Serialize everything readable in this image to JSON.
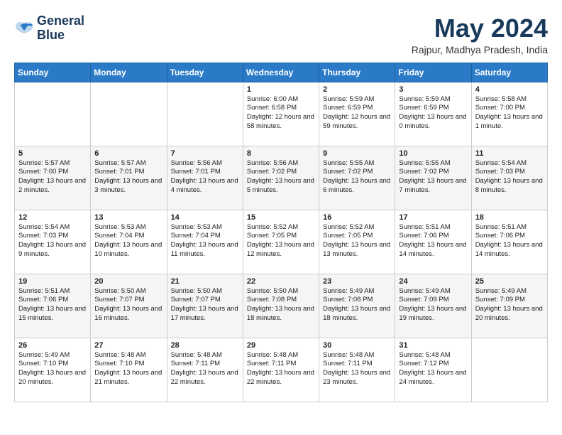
{
  "logo": {
    "line1": "General",
    "line2": "Blue"
  },
  "title": "May 2024",
  "location": "Rajpur, Madhya Pradesh, India",
  "headers": [
    "Sunday",
    "Monday",
    "Tuesday",
    "Wednesday",
    "Thursday",
    "Friday",
    "Saturday"
  ],
  "weeks": [
    [
      {
        "day": "",
        "sunrise": "",
        "sunset": "",
        "daylight": ""
      },
      {
        "day": "",
        "sunrise": "",
        "sunset": "",
        "daylight": ""
      },
      {
        "day": "",
        "sunrise": "",
        "sunset": "",
        "daylight": ""
      },
      {
        "day": "1",
        "sunrise": "Sunrise: 6:00 AM",
        "sunset": "Sunset: 6:58 PM",
        "daylight": "Daylight: 12 hours and 58 minutes."
      },
      {
        "day": "2",
        "sunrise": "Sunrise: 5:59 AM",
        "sunset": "Sunset: 6:59 PM",
        "daylight": "Daylight: 12 hours and 59 minutes."
      },
      {
        "day": "3",
        "sunrise": "Sunrise: 5:59 AM",
        "sunset": "Sunset: 6:59 PM",
        "daylight": "Daylight: 13 hours and 0 minutes."
      },
      {
        "day": "4",
        "sunrise": "Sunrise: 5:58 AM",
        "sunset": "Sunset: 7:00 PM",
        "daylight": "Daylight: 13 hours and 1 minute."
      }
    ],
    [
      {
        "day": "5",
        "sunrise": "Sunrise: 5:57 AM",
        "sunset": "Sunset: 7:00 PM",
        "daylight": "Daylight: 13 hours and 2 minutes."
      },
      {
        "day": "6",
        "sunrise": "Sunrise: 5:57 AM",
        "sunset": "Sunset: 7:01 PM",
        "daylight": "Daylight: 13 hours and 3 minutes."
      },
      {
        "day": "7",
        "sunrise": "Sunrise: 5:56 AM",
        "sunset": "Sunset: 7:01 PM",
        "daylight": "Daylight: 13 hours and 4 minutes."
      },
      {
        "day": "8",
        "sunrise": "Sunrise: 5:56 AM",
        "sunset": "Sunset: 7:02 PM",
        "daylight": "Daylight: 13 hours and 5 minutes."
      },
      {
        "day": "9",
        "sunrise": "Sunrise: 5:55 AM",
        "sunset": "Sunset: 7:02 PM",
        "daylight": "Daylight: 13 hours and 6 minutes."
      },
      {
        "day": "10",
        "sunrise": "Sunrise: 5:55 AM",
        "sunset": "Sunset: 7:02 PM",
        "daylight": "Daylight: 13 hours and 7 minutes."
      },
      {
        "day": "11",
        "sunrise": "Sunrise: 5:54 AM",
        "sunset": "Sunset: 7:03 PM",
        "daylight": "Daylight: 13 hours and 8 minutes."
      }
    ],
    [
      {
        "day": "12",
        "sunrise": "Sunrise: 5:54 AM",
        "sunset": "Sunset: 7:03 PM",
        "daylight": "Daylight: 13 hours and 9 minutes."
      },
      {
        "day": "13",
        "sunrise": "Sunrise: 5:53 AM",
        "sunset": "Sunset: 7:04 PM",
        "daylight": "Daylight: 13 hours and 10 minutes."
      },
      {
        "day": "14",
        "sunrise": "Sunrise: 5:53 AM",
        "sunset": "Sunset: 7:04 PM",
        "daylight": "Daylight: 13 hours and 11 minutes."
      },
      {
        "day": "15",
        "sunrise": "Sunrise: 5:52 AM",
        "sunset": "Sunset: 7:05 PM",
        "daylight": "Daylight: 13 hours and 12 minutes."
      },
      {
        "day": "16",
        "sunrise": "Sunrise: 5:52 AM",
        "sunset": "Sunset: 7:05 PM",
        "daylight": "Daylight: 13 hours and 13 minutes."
      },
      {
        "day": "17",
        "sunrise": "Sunrise: 5:51 AM",
        "sunset": "Sunset: 7:06 PM",
        "daylight": "Daylight: 13 hours and 14 minutes."
      },
      {
        "day": "18",
        "sunrise": "Sunrise: 5:51 AM",
        "sunset": "Sunset: 7:06 PM",
        "daylight": "Daylight: 13 hours and 14 minutes."
      }
    ],
    [
      {
        "day": "19",
        "sunrise": "Sunrise: 5:51 AM",
        "sunset": "Sunset: 7:06 PM",
        "daylight": "Daylight: 13 hours and 15 minutes."
      },
      {
        "day": "20",
        "sunrise": "Sunrise: 5:50 AM",
        "sunset": "Sunset: 7:07 PM",
        "daylight": "Daylight: 13 hours and 16 minutes."
      },
      {
        "day": "21",
        "sunrise": "Sunrise: 5:50 AM",
        "sunset": "Sunset: 7:07 PM",
        "daylight": "Daylight: 13 hours and 17 minutes."
      },
      {
        "day": "22",
        "sunrise": "Sunrise: 5:50 AM",
        "sunset": "Sunset: 7:08 PM",
        "daylight": "Daylight: 13 hours and 18 minutes."
      },
      {
        "day": "23",
        "sunrise": "Sunrise: 5:49 AM",
        "sunset": "Sunset: 7:08 PM",
        "daylight": "Daylight: 13 hours and 18 minutes."
      },
      {
        "day": "24",
        "sunrise": "Sunrise: 5:49 AM",
        "sunset": "Sunset: 7:09 PM",
        "daylight": "Daylight: 13 hours and 19 minutes."
      },
      {
        "day": "25",
        "sunrise": "Sunrise: 5:49 AM",
        "sunset": "Sunset: 7:09 PM",
        "daylight": "Daylight: 13 hours and 20 minutes."
      }
    ],
    [
      {
        "day": "26",
        "sunrise": "Sunrise: 5:49 AM",
        "sunset": "Sunset: 7:10 PM",
        "daylight": "Daylight: 13 hours and 20 minutes."
      },
      {
        "day": "27",
        "sunrise": "Sunrise: 5:48 AM",
        "sunset": "Sunset: 7:10 PM",
        "daylight": "Daylight: 13 hours and 21 minutes."
      },
      {
        "day": "28",
        "sunrise": "Sunrise: 5:48 AM",
        "sunset": "Sunset: 7:11 PM",
        "daylight": "Daylight: 13 hours and 22 minutes."
      },
      {
        "day": "29",
        "sunrise": "Sunrise: 5:48 AM",
        "sunset": "Sunset: 7:11 PM",
        "daylight": "Daylight: 13 hours and 22 minutes."
      },
      {
        "day": "30",
        "sunrise": "Sunrise: 5:48 AM",
        "sunset": "Sunset: 7:11 PM",
        "daylight": "Daylight: 13 hours and 23 minutes."
      },
      {
        "day": "31",
        "sunrise": "Sunrise: 5:48 AM",
        "sunset": "Sunset: 7:12 PM",
        "daylight": "Daylight: 13 hours and 24 minutes."
      },
      {
        "day": "",
        "sunrise": "",
        "sunset": "",
        "daylight": ""
      }
    ]
  ]
}
